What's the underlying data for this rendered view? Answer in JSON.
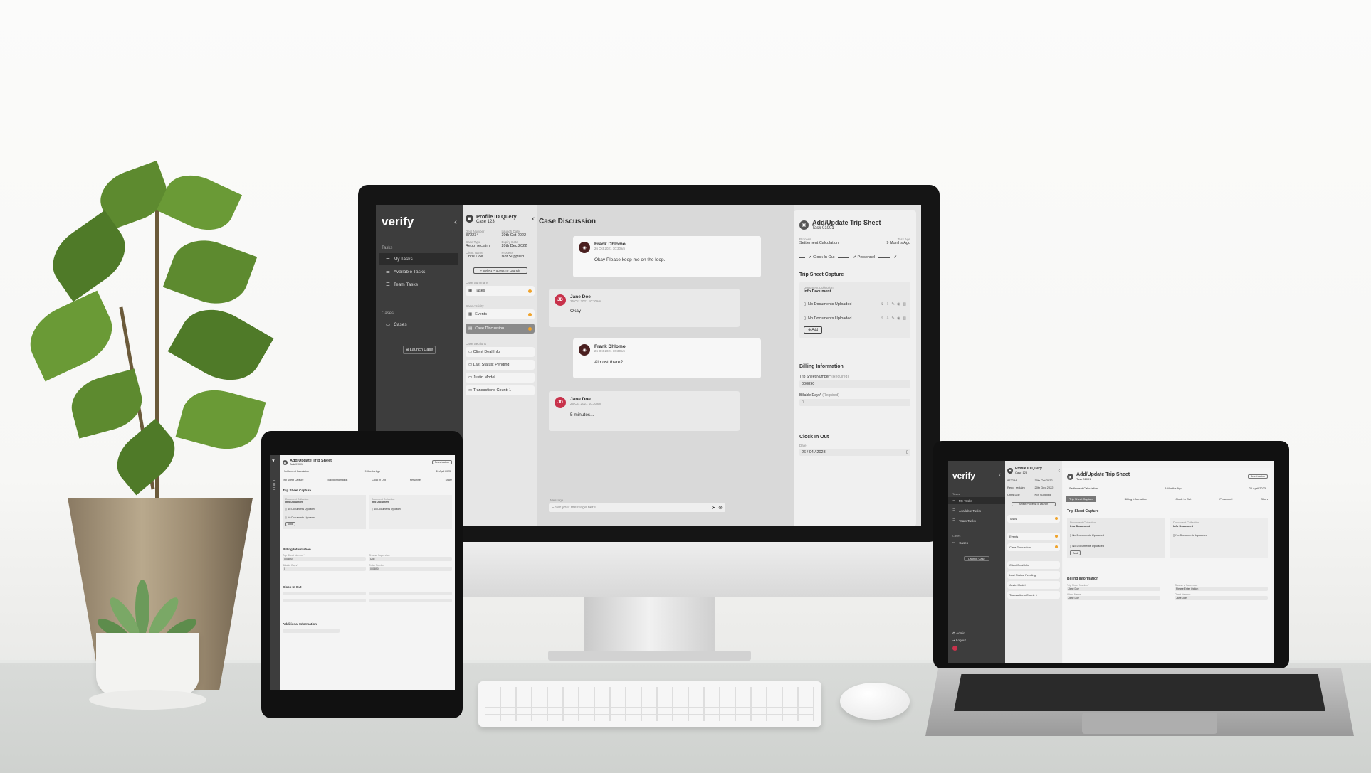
{
  "desktop": {
    "sidebar": {
      "logo": "verify",
      "sections": [
        {
          "label": "Tasks",
          "items": [
            "My Tasks",
            "Available Tasks",
            "Team Tasks"
          ]
        },
        {
          "label": "Cases",
          "items": [
            "Cases"
          ]
        }
      ],
      "launch_case": "Launch Case"
    },
    "case_panel": {
      "title": "Profile ID Query",
      "subtitle": "Case 123",
      "fields": [
        {
          "label": "Deal Number",
          "value": "872234"
        },
        {
          "label": "Launch Date",
          "value": "30th Oct 2022"
        },
        {
          "label": "Case Type",
          "value": "Repo_reclaim"
        },
        {
          "label": "Expiry Date",
          "value": "20th Dec 2022"
        },
        {
          "label": "Client Name",
          "value": "Chris  Doe"
        },
        {
          "label": "Process",
          "value": "Not Supplied"
        }
      ],
      "select_process": "Select Process To Launch",
      "summary_label": "Case Summary",
      "summary_items": [
        "Tasks"
      ],
      "activity_label": "Case Activity",
      "activity_items": [
        "Events",
        "Case Discussion"
      ],
      "sections_label": "Case Sections",
      "section_items": [
        "Client Deal Info",
        "Last Status: Pending",
        "Justin Model",
        "Transactions Count: 1"
      ]
    },
    "discussion": {
      "title": "Case Discussion",
      "messages": [
        {
          "initials": "",
          "name": "Frank Dhlomo",
          "time": "26 Oct 2021 10:30am",
          "text": "Okay Please keep me on the loop.",
          "side": "right"
        },
        {
          "initials": "JD",
          "name": "Jane Doe",
          "time": "26 Oct 2021 10:30am",
          "text": "Okay",
          "side": "left"
        },
        {
          "initials": "",
          "name": "Frank Dhlomo",
          "time": "26 Oct 2021 10:30am",
          "text": "Almost there?",
          "side": "right"
        },
        {
          "initials": "JD",
          "name": "Jane Doe",
          "time": "26 Oct 2021 10:30am",
          "text": "5 minutes...",
          "side": "left"
        }
      ],
      "message_label": "Message",
      "message_placeholder": "Enter your message here"
    },
    "trip": {
      "title": "Add/Update Trip Sheet",
      "subtitle": "Task 01001",
      "process_label": "Process",
      "process_value": "Settlement Calculation",
      "age_label": "Task Age",
      "age_value": "9 Months Ago",
      "steps": [
        "Clock In Out",
        "Personnel"
      ],
      "capture_title": "Trip Sheet Capture",
      "doc_collection_label": "Document Collection",
      "doc_name": "Info Document",
      "doc_rows": [
        "No Documents Uploaded",
        "No Documents Uploaded"
      ],
      "add_label": "Add",
      "billing_title": "Billing Information",
      "trip_number_label": "Trip Sheet Number*",
      "trip_number_req": "(Required)",
      "trip_number_value": "000890",
      "billable_label": "Billable Days*",
      "billable_req": "(Required)",
      "billable_value": "0",
      "clock_title": "Clock In Out",
      "date_label": "Date",
      "date_value": "26 / 04 / 2023"
    }
  },
  "tablet": {
    "title": "Add/Update Trip Sheet",
    "subtitle": "Task 01001",
    "action_button": "Select Action",
    "process_value": "Settlement Calculation",
    "age_value": "9 Months Ago",
    "date_value": "26 April 2023",
    "steps": [
      "Trip Sheet Capture",
      "Billing Information",
      "Clock In Out",
      "Personnel",
      "Share"
    ],
    "capture_title": "Trip Sheet Capture",
    "doc_collection_label": "Document Collection",
    "doc_name_a": "Info Document",
    "doc_name_b": "Info Document",
    "doc_rows": [
      "No Documents Uploaded",
      "No Documents Uploaded"
    ],
    "doc_row_b": "No Documents Uploaded",
    "add_label": "Add",
    "billing_title": "Billing Information",
    "billing_fields": [
      {
        "label": "Trip Sheet Number*",
        "value": "000890"
      },
      {
        "label": "Choose Supervisor",
        "value": "Udo"
      },
      {
        "label": "Billable Days*",
        "value": "0"
      },
      {
        "label": "Order Number",
        "value": "000890"
      }
    ],
    "clock_title": "Clock In Out",
    "additional_title": "Additional Information"
  },
  "laptop": {
    "sidebar": {
      "logo": "verify",
      "tasks_label": "Tasks",
      "items": [
        "My Tasks",
        "Available Tasks",
        "Team Tasks"
      ],
      "cases_label": "Cases",
      "case_items": [
        "Cases"
      ],
      "launch_case": "Launch Case",
      "bottom_items": [
        "Admin",
        "Logout"
      ]
    },
    "case_panel": {
      "title": "Profile ID Query",
      "subtitle": "Case 123",
      "values": [
        "872234",
        "30th Oct 2022",
        "Repo_reclaim",
        "20th Dec 2022",
        "Chris  Doe",
        "Not Supplied"
      ],
      "select_process": "Select Process To Launch",
      "summary_items": [
        "Tasks"
      ],
      "activity_items": [
        "Events",
        "Case Discussion"
      ],
      "section_items": [
        "Client Deal Info",
        "Last Status: Pending",
        "Justin Model",
        "Transactions Count: 1"
      ]
    },
    "trip": {
      "title": "Add/Update Trip Sheet",
      "subtitle": "Task 01001",
      "action_button": "Select Action",
      "process_value": "Settlement Calculation",
      "age_value": "9 Months Ago",
      "date_value": "26 April 2023",
      "steps": [
        "Trip Sheet Capture",
        "Billing Information",
        "Clock In Out",
        "Personnel",
        "Share"
      ],
      "capture_title": "Trip Sheet Capture",
      "doc_collection_label": "Document Collection",
      "doc_name_a": "Info Document",
      "doc_name_b": "Info Document",
      "doc_rows": [
        "No Documents Uploaded",
        "No Documents Uploaded"
      ],
      "doc_row_b": "No Documents Uploaded",
      "add_label": "Add",
      "billing_title": "Billing Information",
      "billing_fields": [
        {
          "label": "Trip Sheet Number*",
          "value": "Jane Doe"
        },
        {
          "label": "Choose a Supervisor",
          "value": "Please Enter Option"
        },
        {
          "label": "Client Name",
          "value": "Jane Doe"
        },
        {
          "label": "Client Number",
          "value": "Jane Doe"
        }
      ]
    }
  },
  "colors": {
    "sidebar": "#3d3d3d",
    "accent_orange": "#f0a32b",
    "avatar_red": "#c8324b",
    "panel": "#e2e2e2"
  }
}
